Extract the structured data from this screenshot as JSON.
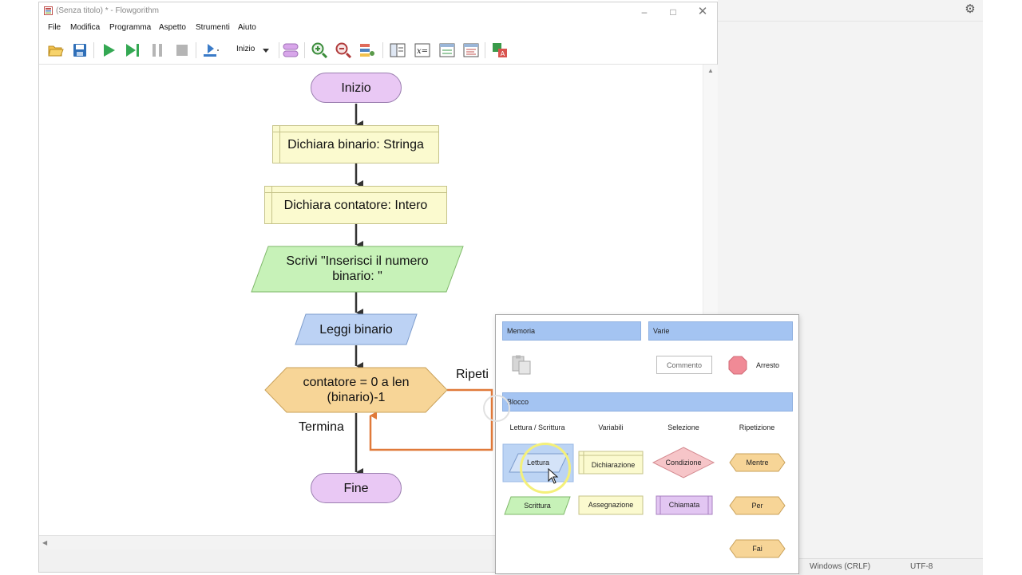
{
  "window": {
    "title": "(Senza titolo) * - Flowgorithm",
    "minimize_icon": "minimize-icon",
    "maximize_icon": "maximize-icon",
    "close_icon": "close-icon"
  },
  "menu": [
    "File",
    "Modifica",
    "Programma",
    "Aspetto",
    "Strumenti",
    "Aiuto"
  ],
  "toolbar": {
    "run_from_label": "Inizio",
    "icons": [
      "open-folder-icon",
      "save-icon",
      "run-icon",
      "step-icon",
      "pause-icon",
      "stop-icon",
      "speed-icon",
      "dropdown-arrow-icon",
      "layout-icon",
      "zoom-in-icon",
      "zoom-out-icon",
      "style-icon",
      "panels-icon",
      "variables-icon",
      "console-icon",
      "source-code-icon",
      "translate-icon"
    ]
  },
  "flowchart": {
    "start": "Inizio",
    "declare_1": "Dichiara binario: Stringa",
    "declare_2": "Dichiara contatore: Intero",
    "output_line1": "Scrivi \"Inserisci il numero",
    "output_line2": "binario: \"",
    "input": "Leggi binario",
    "loop_line1": "contatore = 0 a len",
    "loop_line2": "(binario)-1",
    "loop_repeat_label": "Ripeti",
    "loop_exit_label": "Termina",
    "end": "Fine"
  },
  "palette": {
    "section_memoria": "Memoria",
    "section_varie": "Varie",
    "section_blocco": "Blocco",
    "clipboard_icon": "clipboard-icon",
    "comment": "Commento",
    "stop": "Arresto",
    "columns": [
      "Lettura / Scrittura",
      "Variabili",
      "Selezione",
      "Ripetizione"
    ],
    "items": {
      "read": "Lettura",
      "write": "Scrittura",
      "declare": "Dichiarazione",
      "assign": "Assegnazione",
      "condition": "Condizione",
      "call": "Chiamata",
      "while": "Mentre",
      "for": "Per",
      "do": "Fai"
    }
  },
  "background_editor": {
    "status_line_ending": "Windows (CRLF)",
    "status_encoding": "UTF-8",
    "gear_icon": "gear-icon"
  },
  "colors": {
    "terminal": "#e9c8f4",
    "declare": "#fbfacf",
    "output": "#c7f2b8",
    "input": "#bcd2f4",
    "loop": "#f7d597",
    "loop_arrow": "#e07a3a",
    "palette_header": "#a4c4f2",
    "arresto": "#f08a96"
  }
}
